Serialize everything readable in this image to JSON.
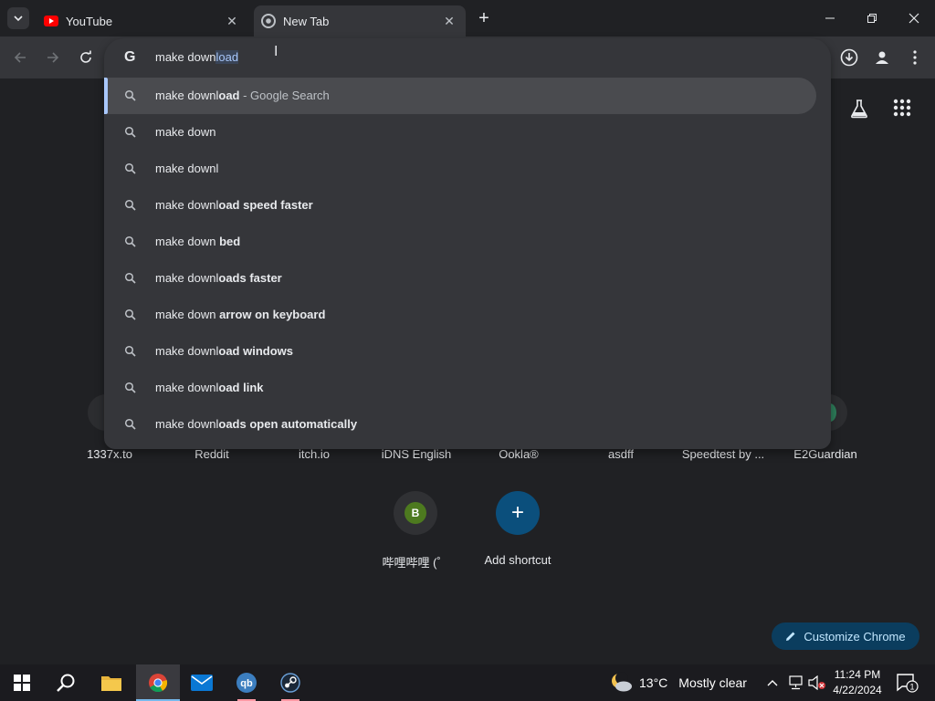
{
  "tabs": [
    {
      "title": "YouTube",
      "favicon": "youtube-icon",
      "active": false
    },
    {
      "title": "New Tab",
      "favicon": "chrome-icon",
      "active": true
    }
  ],
  "omnibox": {
    "typed": "make down",
    "autocomplete": "load",
    "suggestions": [
      {
        "typed": "make downl",
        "completion": "oad",
        "description": " - Google Search",
        "selected": true
      },
      {
        "typed": "make down",
        "completion": "",
        "description": ""
      },
      {
        "typed": "make downl",
        "completion": "",
        "description": ""
      },
      {
        "typed": "make downl",
        "completion": "oad speed faster",
        "description": ""
      },
      {
        "typed": "make down",
        "completion": " bed",
        "description": ""
      },
      {
        "typed": "make downl",
        "completion": "oads faster",
        "description": ""
      },
      {
        "typed": "make down",
        "completion": " arrow on keyboard",
        "description": ""
      },
      {
        "typed": "make downl",
        "completion": "oad windows",
        "description": ""
      },
      {
        "typed": "make downl",
        "completion": "oad link",
        "description": ""
      },
      {
        "typed": "make downl",
        "completion": "oads open automatically",
        "description": ""
      }
    ]
  },
  "shortcuts": {
    "row1": [
      "1337x.to",
      "Reddit",
      "itch.io",
      "iDNS English",
      "Ookla®",
      "asdff",
      "Speedtest by ...",
      "E2Guardian"
    ],
    "row2": [
      {
        "label": "哔哩哔哩 (゜",
        "letter": "B",
        "color": "#4d7a1f"
      },
      {
        "label": "Add shortcut",
        "letter": "+",
        "color": "#0b4f7c"
      }
    ]
  },
  "customize_label": "Customize Chrome",
  "taskbar": {
    "weather_temp": "13°C",
    "weather_desc": "Mostly clear",
    "time": "11:24 PM",
    "date": "4/22/2024",
    "notification_count": "1"
  }
}
